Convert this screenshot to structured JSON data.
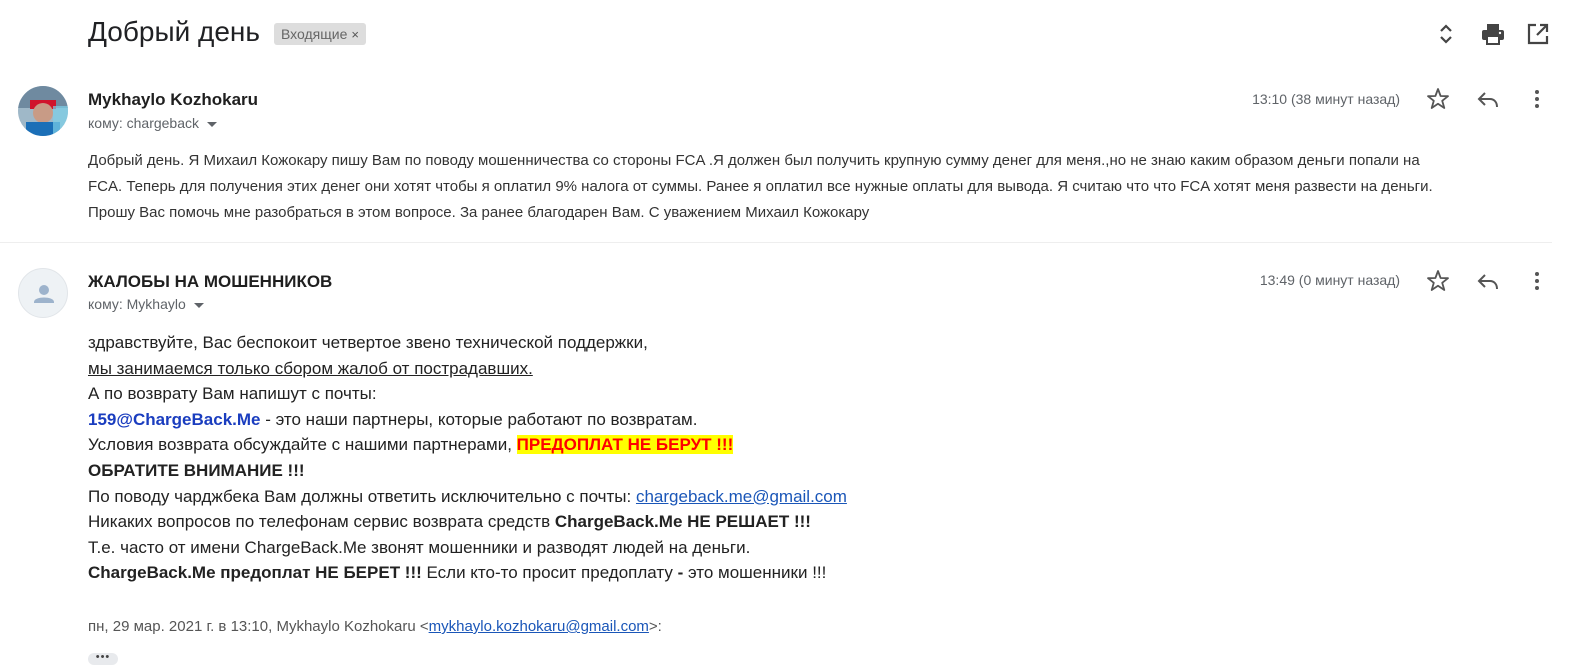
{
  "subject": "Добрый день",
  "label_chip": {
    "text": "Входящие",
    "close": "×"
  },
  "top_icons": [
    "expand-collapse-icon",
    "print-icon",
    "open-in-new-window-icon"
  ],
  "messages": [
    {
      "sender": "Mykhaylo Kozhokaru",
      "to": "кому: chargeback",
      "time": "13:10 (38 минут назад)",
      "body": [
        "Добрый день. Я Михаил Кожокару пишу Вам по поводу мошенничества со стороны FCA .Я должен был получить крупную сумму денег для меня.,но не знаю каким образом деньги попали на",
        "FCA. Теперь для получения этих денег они хотят чтобы я оплатил 9% налога от суммы. Ранее я оплатил все нужные оплаты для вывода. Я считаю что что FCA хотят меня развести на деньги.",
        "Прошу Вас помочь мне разобраться в этом вопросе. За ранее благодарен Вам. С уважением Михаил Кожокару"
      ]
    },
    {
      "sender": "ЖАЛОБЫ НА МОШЕННИКОВ",
      "to": "кому: Mykhaylo",
      "time": "13:49 (0 минут назад)",
      "body": {
        "l1": "здравствуйте, Вас беспокоит четвертое звено технической поддержки,",
        "l2": "мы занимаемся только сбором жалоб от пострадавших.",
        "l3": "А по возврату Вам напишут с почты:",
        "l4_email": "159@ChargeBack.Me",
        "l4_rest": " - это наши партнеры, которые работают по возвратам.",
        "l5_text": "Условия возврата обсуждайте с нашими партнерами, ",
        "l5_highlight": "ПРЕДОПЛАТ НЕ БЕРУТ !!!",
        "l6": "ОБРАТИТЕ ВНИМАНИЕ !!!",
        "l7_text": "По поводу чарджбека Вам должны ответить исключительно с почты: ",
        "l7_link": "chargeback.me@gmail.com",
        "l8_text": "Никаких вопросов по телефонам сервис возврата средств ",
        "l8_bold": "ChargeBack.Me НЕ РЕШАЕТ !!!",
        "l9": "Т.е. часто от имени ChargeBack.Me звонят мошенники и разводят людей на деньги.",
        "l10_bold": "ChargeBack.Me предоплат НЕ БЕРЕТ !!!",
        "l10_text": " Если кто-то просит предоплату ",
        "l10_dash": "-",
        "l10_end": " это мошенники !!!"
      },
      "quote_prefix": "пн, 29 мар. 2021 г. в 13:10, Mykhaylo Kozhokaru <",
      "quote_email": "mykhaylo.kozhokaru@gmail.com",
      "quote_suffix": ">:",
      "show_trimmed": "•••"
    }
  ],
  "colors": {
    "highlight_bg": "#ffff00",
    "highlight_text": "#ff0000",
    "partner_email": "#1a3dbf",
    "link": "#1a56b8"
  }
}
